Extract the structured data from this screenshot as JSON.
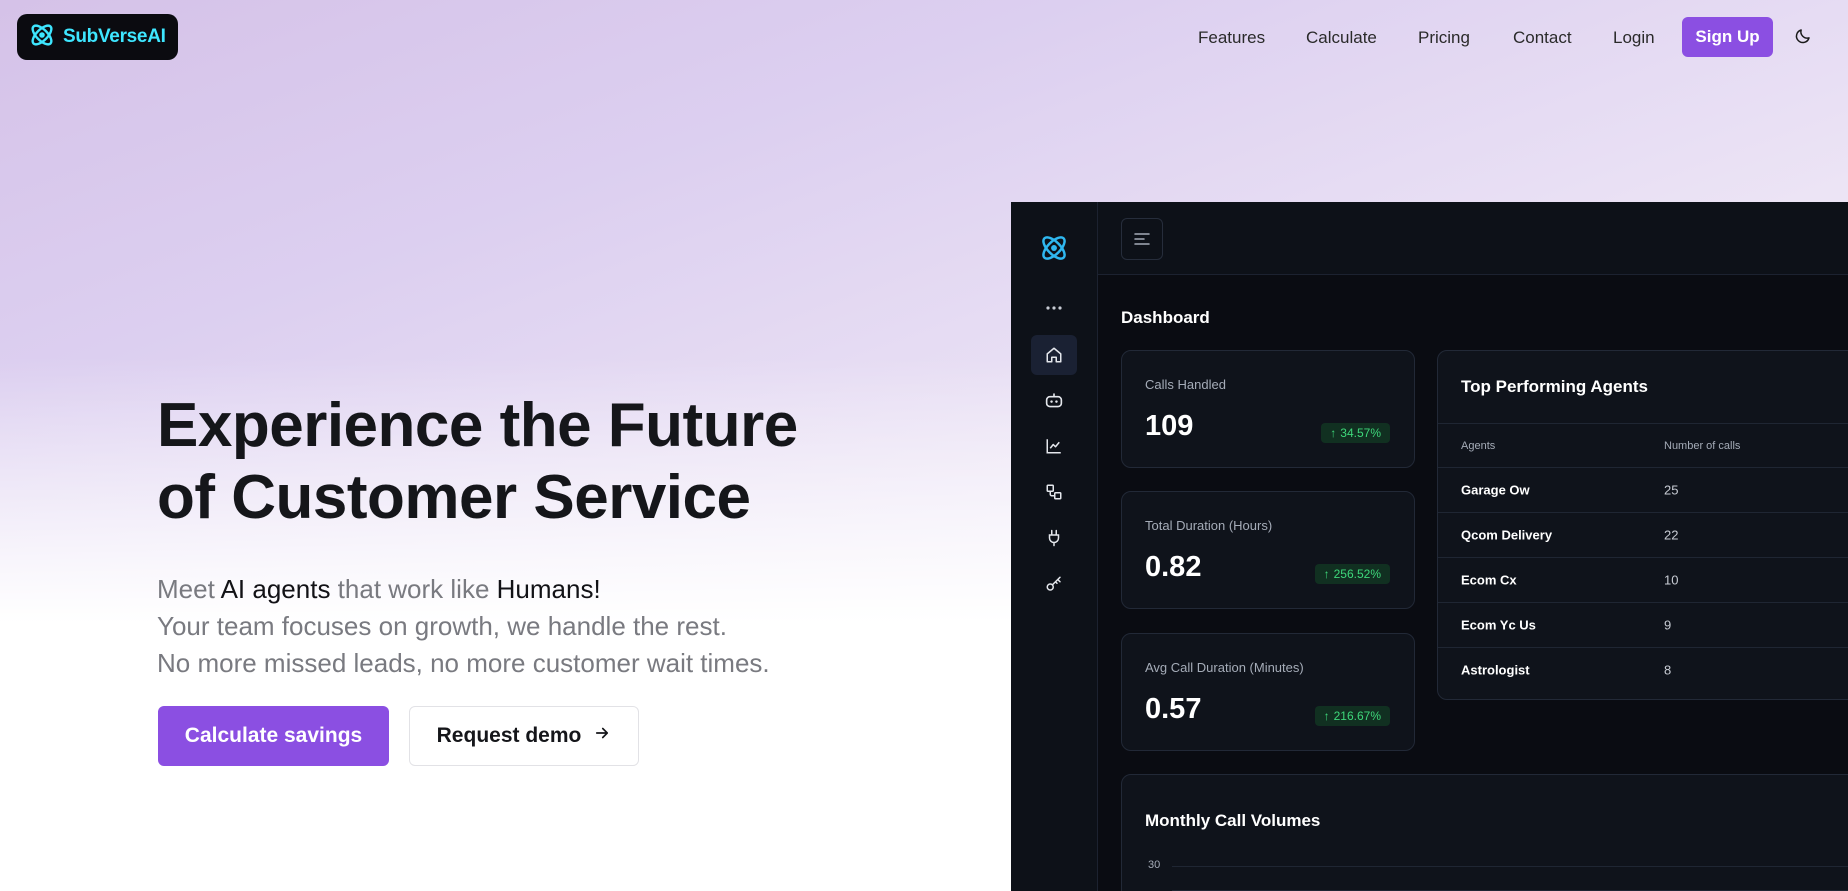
{
  "brand": {
    "name": "SubVerseAI"
  },
  "nav": {
    "items": [
      "Features",
      "Calculate",
      "Pricing",
      "Contact",
      "Login"
    ],
    "signup": "Sign Up",
    "theme_icon": "moon-icon"
  },
  "hero": {
    "title_line1": "Experience the Future",
    "title_line2": "of Customer Service",
    "sub": {
      "meet": "Meet ",
      "ai_agents": "AI agents",
      "work_like": " that work like ",
      "humans": "Humans!",
      "line2": "Your team focuses on growth, we handle the rest.",
      "line3": "No more missed leads, no more customer wait times."
    },
    "cta_primary": "Calculate savings",
    "cta_secondary": "Request demo"
  },
  "dashboard": {
    "title": "Dashboard",
    "kpis": [
      {
        "label": "Calls Handled",
        "value": "109",
        "change": "34.57%"
      },
      {
        "label": "Total Duration (Hours)",
        "value": "0.82",
        "change": "256.52%"
      },
      {
        "label": "Avg Call Duration (Minutes)",
        "value": "0.57",
        "change": "216.67%"
      }
    ],
    "agents": {
      "title": "Top Performing Agents",
      "columns": [
        "Agents",
        "Number of calls"
      ],
      "rows": [
        {
          "name": "Garage Ow",
          "calls": "25"
        },
        {
          "name": "Qcom Delivery",
          "calls": "22"
        },
        {
          "name": "Ecom Cx",
          "calls": "10"
        },
        {
          "name": "Ecom Yc Us",
          "calls": "9"
        },
        {
          "name": "Astrologist",
          "calls": "8"
        }
      ]
    },
    "monthly": {
      "title": "Monthly Call Volumes",
      "ticks": [
        "30"
      ]
    }
  },
  "colors": {
    "accent": "#8b4fe2",
    "logo_cyan": "#3ee6ff",
    "positive": "#3ed77a"
  }
}
